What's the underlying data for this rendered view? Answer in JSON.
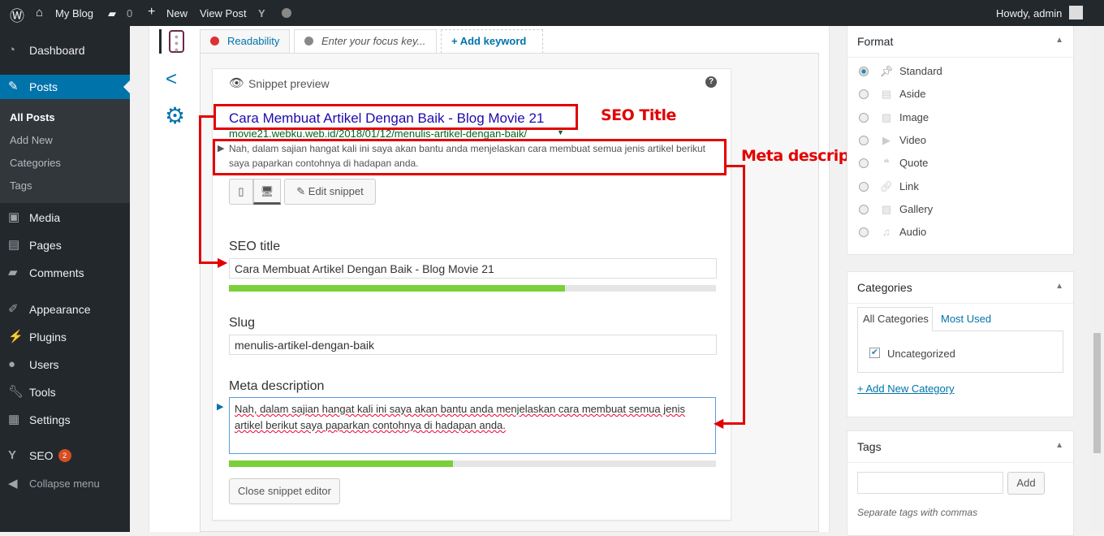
{
  "adminbar": {
    "site": "My Blog",
    "comments": "0",
    "new": "New",
    "view_post": "View Post",
    "greeting": "Howdy, admin"
  },
  "sidebar": {
    "items": [
      {
        "label": "Dashboard"
      },
      {
        "label": "Posts"
      },
      {
        "label": "Media"
      },
      {
        "label": "Pages"
      },
      {
        "label": "Comments"
      },
      {
        "label": "Appearance"
      },
      {
        "label": "Plugins"
      },
      {
        "label": "Users"
      },
      {
        "label": "Tools"
      },
      {
        "label": "Settings"
      },
      {
        "label": "SEO",
        "badge": "2"
      },
      {
        "label": "Collapse menu"
      }
    ],
    "posts_sub": [
      "All Posts",
      "Add New",
      "Categories",
      "Tags"
    ]
  },
  "yoast": {
    "tabs": {
      "readability": "Readability",
      "focus_placeholder": "Enter your focus key...",
      "add_keyword": "+ Add keyword"
    },
    "snippet_heading": "Snippet preview",
    "preview": {
      "title": "Cara Membuat Artikel Dengan Baik - Blog Movie 21",
      "url": "movie21.webku.web.id/2018/01/12/menulis-artikel-dengan-baik/",
      "description": "Nah, dalam sajian hangat kali ini saya akan bantu anda menjelaskan cara membuat semua jenis artikel berikut saya paparkan contohnya di hadapan anda."
    },
    "edit_snippet": "Edit snippet",
    "seo_title_label": "SEO title",
    "seo_title_value": "Cara Membuat Artikel Dengan Baik - Blog Movie 21",
    "seo_title_progress": 0.69,
    "slug_label": "Slug",
    "slug_value": "menulis-artikel-dengan-baik",
    "meta_label": "Meta description",
    "meta_value": "Nah, dalam sajian hangat kali ini saya akan bantu anda menjelaskan cara membuat semua jenis artikel berikut saya paparkan contohnya di hadapan anda.",
    "meta_progress": 0.46,
    "close_editor": "Close snippet editor"
  },
  "annotations": {
    "seo_title": "SEO Title",
    "meta": "Meta description"
  },
  "format": {
    "title": "Format",
    "options": [
      "Standard",
      "Aside",
      "Image",
      "Video",
      "Quote",
      "Link",
      "Gallery",
      "Audio"
    ],
    "selected": "Standard"
  },
  "categories": {
    "title": "Categories",
    "tab_all": "All Categories",
    "tab_used": "Most Used",
    "items": [
      {
        "label": "Uncategorized",
        "checked": true
      }
    ],
    "add_new": "+ Add New Category"
  },
  "tags": {
    "title": "Tags",
    "add": "Add",
    "hint": "Separate tags with commas"
  }
}
